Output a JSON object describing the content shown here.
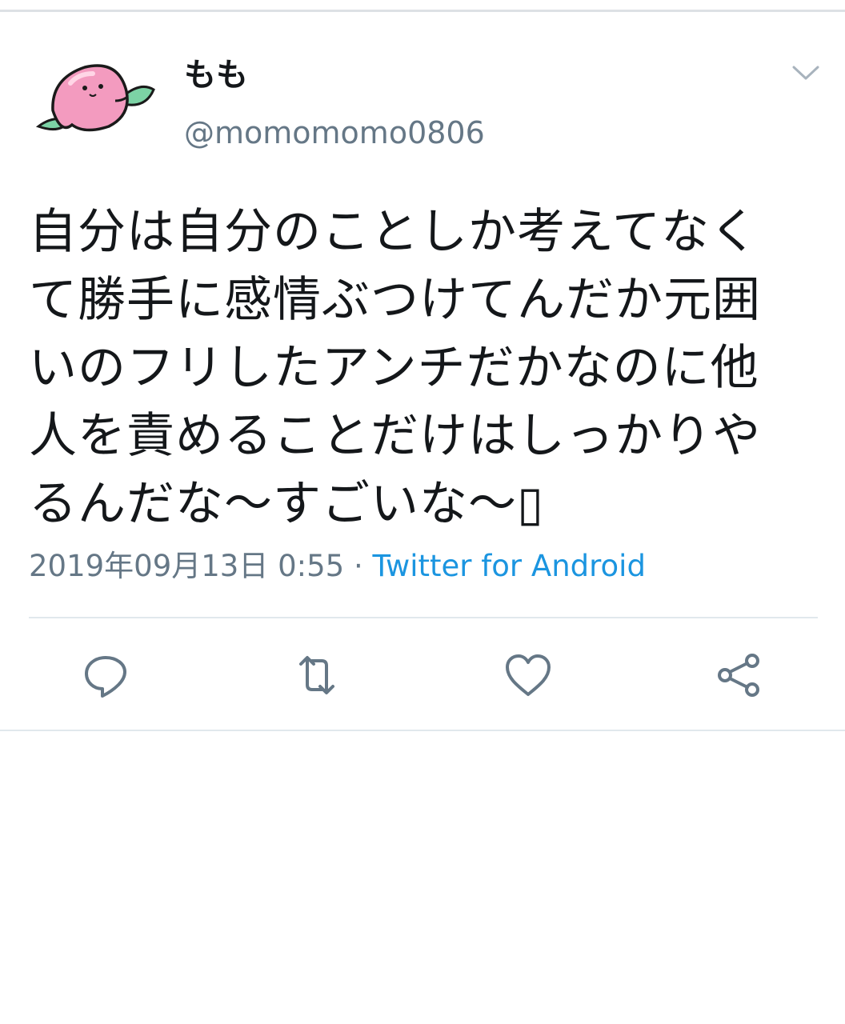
{
  "user": {
    "display_name": "もも",
    "handle": "@momomomo0806",
    "avatar_icon": "peach-avatar-icon"
  },
  "tweet": {
    "text": "自分は自分のことしか考えてなく\nて勝手に感情ぶつけてんだか元囲\nいのフリしたアンチだかなのに他\n人を責めることだけはしっかりや\nるんだな〜すごいな〜▯",
    "timestamp": "2019年09月13日 0:55",
    "separator": " · ",
    "source": "Twitter for Android"
  },
  "actions": {
    "reply_icon": "reply-icon",
    "retweet_icon": "retweet-icon",
    "like_icon": "heart-icon",
    "share_icon": "share-icon"
  },
  "colors": {
    "text": "#14171a",
    "secondary": "#657786",
    "link": "#1b95e0",
    "icon": "#657786",
    "divider": "#e1e8ed"
  }
}
